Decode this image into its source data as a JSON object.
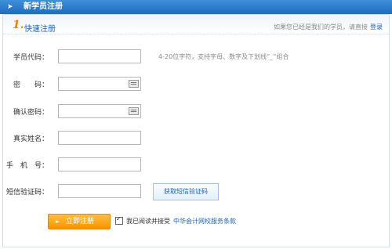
{
  "header": {
    "title": "新学员注册",
    "arrow_icon": "chevron-right-icon"
  },
  "step": {
    "number": "1.",
    "title": "快速注册"
  },
  "login_hint": {
    "text": "如果您已经是我们的学员，请直接",
    "link": "登录"
  },
  "form": {
    "fields": [
      {
        "label": "学员代码：",
        "value": "",
        "has_keyboard": false
      },
      {
        "label": "密　　码：",
        "value": "",
        "has_keyboard": true
      },
      {
        "label": "确认密码：",
        "value": "",
        "has_keyboard": true
      },
      {
        "label": "真实姓名：",
        "value": "",
        "has_keyboard": false
      },
      {
        "label": "手　机　号：",
        "value": "",
        "has_keyboard": false
      },
      {
        "label": "短信验证码：",
        "value": "",
        "has_keyboard": false
      }
    ],
    "student_code_tip": "4-20位字符，支持字母、数字及下划线“_”组合",
    "sms_button": "获取短信验证码"
  },
  "actions": {
    "register_button": "立即注册",
    "agree_checked": true,
    "agree_text": "我已阅读并接受",
    "terms_link": "中华会计网校服务条款"
  }
}
